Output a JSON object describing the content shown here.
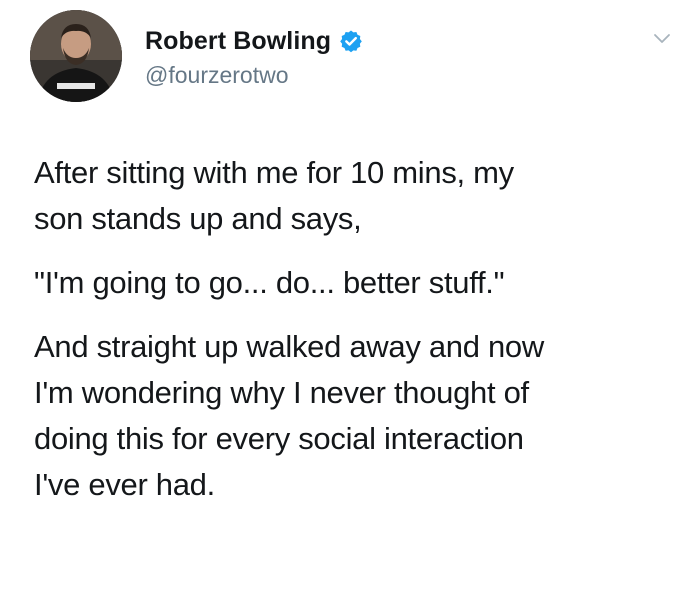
{
  "tweet": {
    "author": {
      "display_name": "Robert Bowling",
      "handle": "@fourzerotwo",
      "verified": true,
      "avatar_icon": "profile-photo",
      "verified_color": "#1da1f2"
    },
    "menu_icon": "chevron-down-icon",
    "paragraphs": [
      "After sitting with me for 10 mins, my\nson stands up and says,",
      "\"I'm going to go... do... better stuff.\"",
      "And straight up walked away and now\nI'm wondering why I never thought of\ndoing this for every social interaction\nI've ever had."
    ]
  }
}
